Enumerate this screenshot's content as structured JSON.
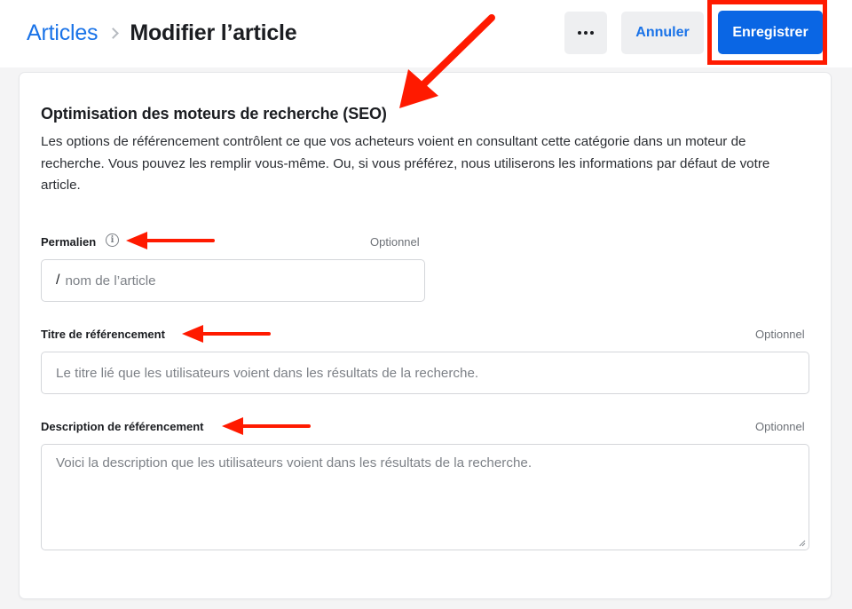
{
  "header": {
    "breadcrumb_link": "Articles",
    "page_title": "Modifier l’article",
    "more_label": "···",
    "cancel_label": "Annuler",
    "save_label": "Enregistrer"
  },
  "seo": {
    "title": "Optimisation des moteurs de recherche (SEO)",
    "description": "Les options de référencement contrôlent ce que vos acheteurs voient en consultant cette catégorie dans un moteur de recherche. Vous pouvez les remplir vous-même. Ou, si vous préférez, nous utiliserons les informations par défaut de votre article.",
    "permalink": {
      "label": "Permalien",
      "optional": "Optionnel",
      "prefix": "/",
      "value": "",
      "placeholder": "nom de l’article"
    },
    "seo_title": {
      "label": "Titre de référencement",
      "optional": "Optionnel",
      "value": "",
      "placeholder": "Le titre lié que les utilisateurs voient dans les résultats de la recherche."
    },
    "seo_description": {
      "label": "Description de référencement",
      "optional": "Optionnel",
      "value": "",
      "placeholder": "Voici la description que les utilisateurs voient dans les résultats de la recherche."
    }
  },
  "icons": {
    "info": "info-icon",
    "breadcrumb_separator": "chevron-right-icon",
    "more": "ellipsis-icon"
  },
  "colors": {
    "accent": "#1a73e8",
    "primary_button": "#0a66e4",
    "annotation": "#ff1a00"
  }
}
